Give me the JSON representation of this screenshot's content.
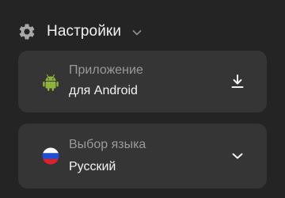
{
  "header": {
    "title": "Настройки",
    "icon": "gear-icon",
    "toggle_icon": "chevron-down-icon"
  },
  "app_card": {
    "label": "Приложение",
    "value": "для Android",
    "icon": "android-icon",
    "action_icon": "download-icon",
    "icon_color": "#8fb33a"
  },
  "language_card": {
    "label": "Выбор языка",
    "value": "Русский",
    "icon": "russia-flag-icon",
    "action_icon": "chevron-down-icon",
    "flag_colors": [
      "#ffffff",
      "#1c4fd3",
      "#d9232f"
    ]
  },
  "colors": {
    "background": "#242424",
    "card": "#353535",
    "label": "#9a9a9a",
    "text": "#f4f4f4"
  }
}
